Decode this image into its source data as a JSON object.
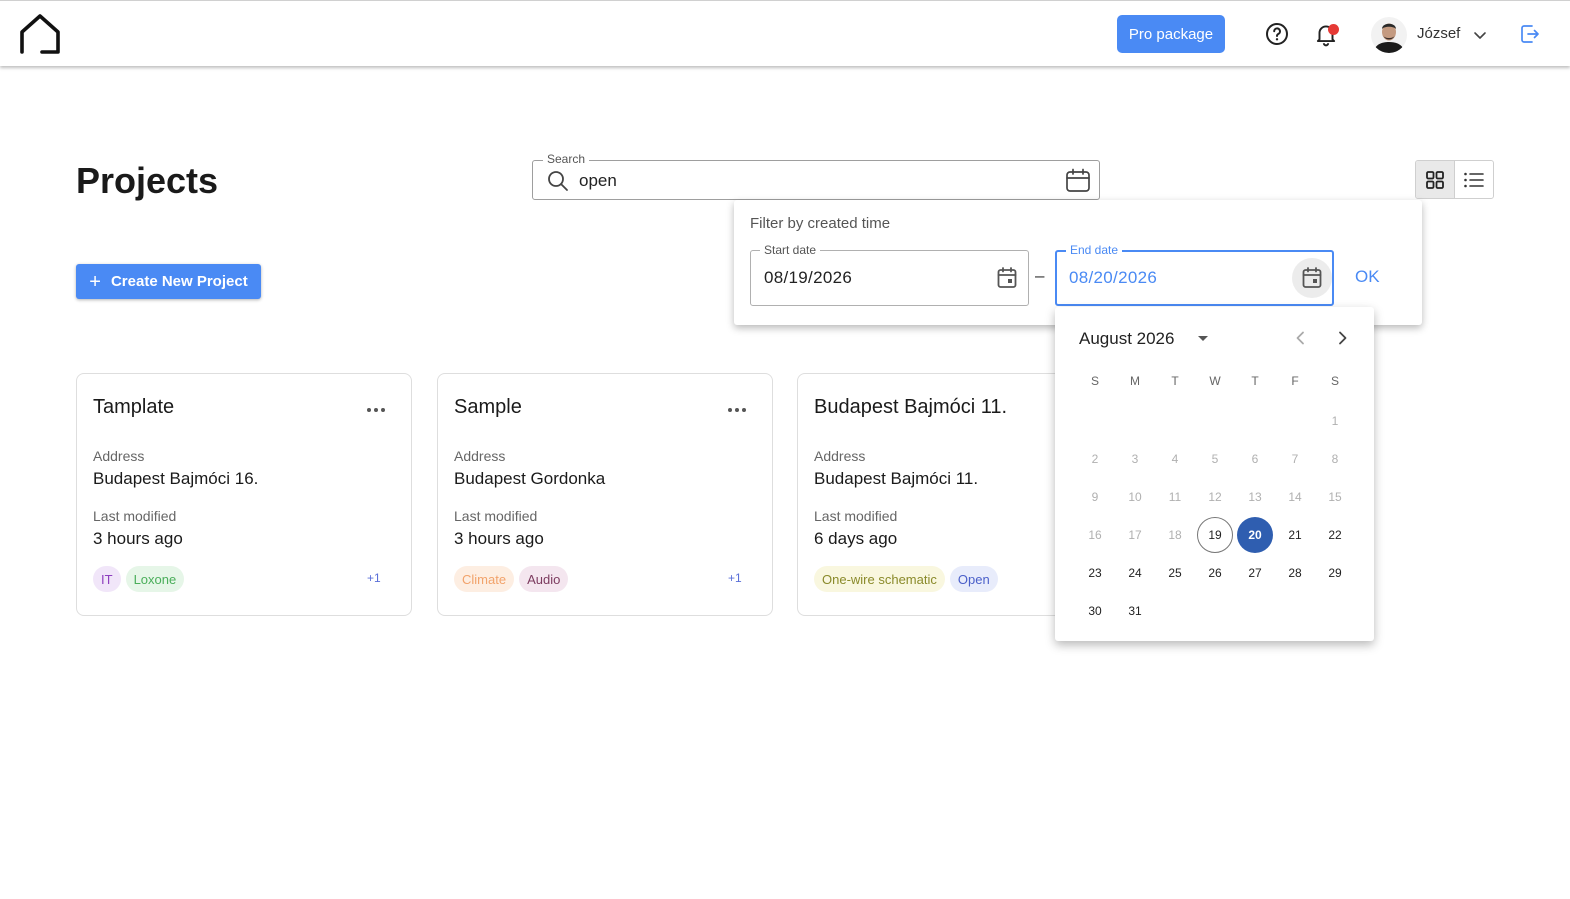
{
  "header": {
    "pro_label": "Pro package",
    "user_name": "József"
  },
  "page": {
    "title": "Projects",
    "create_label": "Create New Project"
  },
  "search": {
    "label": "Search",
    "value": "open"
  },
  "cards": [
    {
      "title": "Tamplate",
      "address_label": "Address",
      "address": "Budapest Bajmóci 16.",
      "modified_label": "Last modified",
      "modified": "3 hours ago",
      "tags": [
        {
          "label": "IT",
          "bg": "#f1e6f9",
          "color": "#8e3fbf"
        },
        {
          "label": "Loxone",
          "bg": "#e6f6e8",
          "color": "#4aae5a"
        }
      ],
      "extra": "+1"
    },
    {
      "title": "Sample",
      "address_label": "Address",
      "address": "Budapest Gordonka",
      "modified_label": "Last modified",
      "modified": "3 hours ago",
      "tags": [
        {
          "label": "Climate",
          "bg": "#fdeee2",
          "color": "#f2a36b"
        },
        {
          "label": "Audio",
          "bg": "#f4e6ef",
          "color": "#7c3b5f"
        }
      ],
      "extra": "+1"
    },
    {
      "title": "Budapest Bajmóci 11.",
      "address_label": "Address",
      "address": "Budapest Bajmóci 11.",
      "modified_label": "Last modified",
      "modified": "6 days ago",
      "tags": [
        {
          "label": "One-wire schematic",
          "bg": "#f9f7df",
          "color": "#8a8a2a"
        },
        {
          "label": "Open",
          "bg": "#e8ecfb",
          "color": "#4a5fc9"
        }
      ],
      "extra": ""
    }
  ],
  "filter": {
    "title": "Filter by created time",
    "start_label": "Start date",
    "start_value": "08/19/2026",
    "end_label": "End date",
    "end_value": "08/20/2026",
    "separator": "–",
    "ok_label": "OK"
  },
  "calendar": {
    "month_label": "August 2026",
    "weekdays": [
      "S",
      "M",
      "T",
      "W",
      "T",
      "F",
      "S"
    ],
    "first_weekday": 6,
    "days_in_month": 31,
    "today": 19,
    "selected": 20,
    "disabled_through": 18
  },
  "colors": {
    "accent": "#4a8af4",
    "selected_day": "#2f5eb0",
    "notification": "#e53935"
  }
}
